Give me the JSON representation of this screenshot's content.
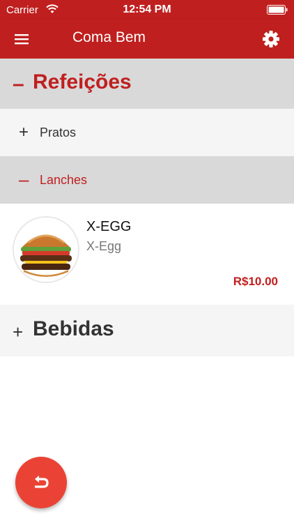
{
  "status_bar": {
    "carrier": "Carrier",
    "time": "12:54 PM"
  },
  "app_bar": {
    "title": "Coma Bem",
    "menu_icon": "hamburger-menu-icon",
    "settings_icon": "gear-icon"
  },
  "categories": [
    {
      "sign": "–",
      "label": "Refeições",
      "expanded": true,
      "subcategories": [
        {
          "sign": "+",
          "label": "Pratos",
          "expanded": false
        },
        {
          "sign": "–",
          "label": "Lanches",
          "expanded": true,
          "products": [
            {
              "name": "X-EGG",
              "description": "X-Egg",
              "price": "R$10.00"
            }
          ]
        }
      ]
    },
    {
      "sign": "+",
      "label": "Bebidas",
      "expanded": false
    }
  ],
  "fab": {
    "icon": "return-icon"
  },
  "colors": {
    "primary": "#c01f1f",
    "fab": "#ea4335",
    "active_bg": "#d9d9d9",
    "inactive_bg": "#f5f5f5"
  }
}
